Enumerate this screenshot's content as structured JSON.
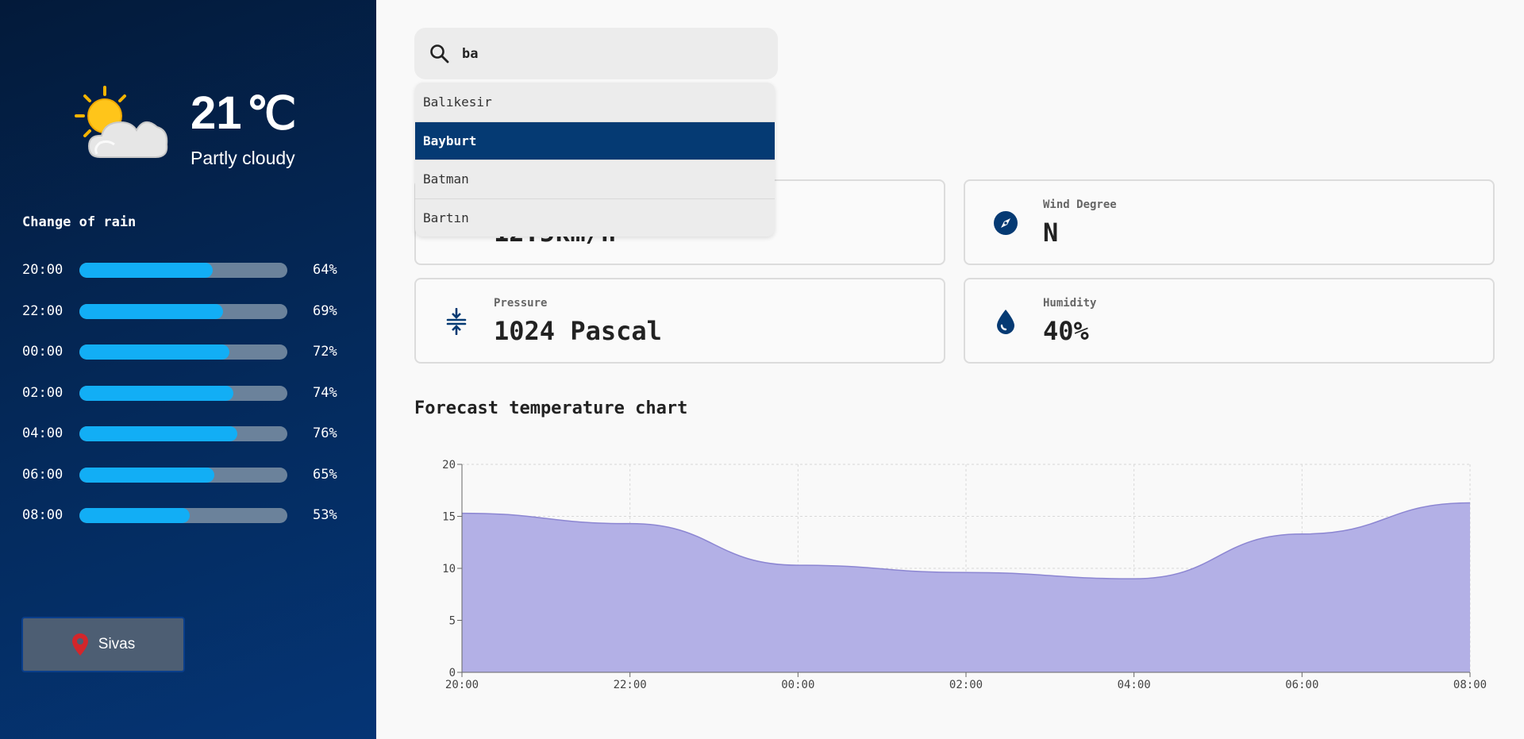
{
  "current": {
    "temperature": "21",
    "unit": "℃",
    "condition": "Partly cloudy",
    "icon": "partly-cloudy-icon"
  },
  "rain": {
    "title": "Change of rain",
    "items": [
      {
        "time": "20:00",
        "percent": 64,
        "label": "64%"
      },
      {
        "time": "22:00",
        "percent": 69,
        "label": "69%"
      },
      {
        "time": "00:00",
        "percent": 72,
        "label": "72%"
      },
      {
        "time": "02:00",
        "percent": 74,
        "label": "74%"
      },
      {
        "time": "04:00",
        "percent": 76,
        "label": "76%"
      },
      {
        "time": "06:00",
        "percent": 65,
        "label": "65%"
      },
      {
        "time": "08:00",
        "percent": 53,
        "label": "53%"
      }
    ]
  },
  "location": {
    "label": "Sivas",
    "icon": "map-pin-icon"
  },
  "search": {
    "value": "ba",
    "icon": "search-icon"
  },
  "dropdown": {
    "items": [
      "Balıkesir",
      "Bayburt",
      "Batman",
      "Bartın"
    ],
    "selected": "Bayburt"
  },
  "cards": {
    "wind_speed": {
      "value": "12.5km/h",
      "icon": "wind-icon"
    },
    "wind_degree": {
      "label": "Wind Degree",
      "value": "N",
      "icon": "compass-icon"
    },
    "pressure": {
      "label": "Pressure",
      "value": "1024 Pascal",
      "icon": "compress-icon"
    },
    "humidity": {
      "label": "Humidity",
      "value": "40%",
      "icon": "water-drop-icon"
    }
  },
  "chart_title": "Forecast temperature chart",
  "colors": {
    "accent": "#053a73",
    "rain_fill": "#12aef5",
    "chart_fill": "#b3b0e6",
    "chart_line": "#8c86d2"
  },
  "chart_data": {
    "type": "area",
    "categories": [
      "20:00",
      "22:00",
      "00:00",
      "02:00",
      "04:00",
      "06:00",
      "08:00"
    ],
    "series": [
      {
        "values": [
          15.3,
          14.3,
          10.3,
          9.6,
          9.0,
          13.3,
          16.3
        ]
      }
    ],
    "yticks": [
      "0",
      "5",
      "10",
      "15",
      "20"
    ],
    "ylim": [
      0,
      20
    ],
    "grid": true,
    "title": "",
    "xlabel": "",
    "ylabel": ""
  }
}
